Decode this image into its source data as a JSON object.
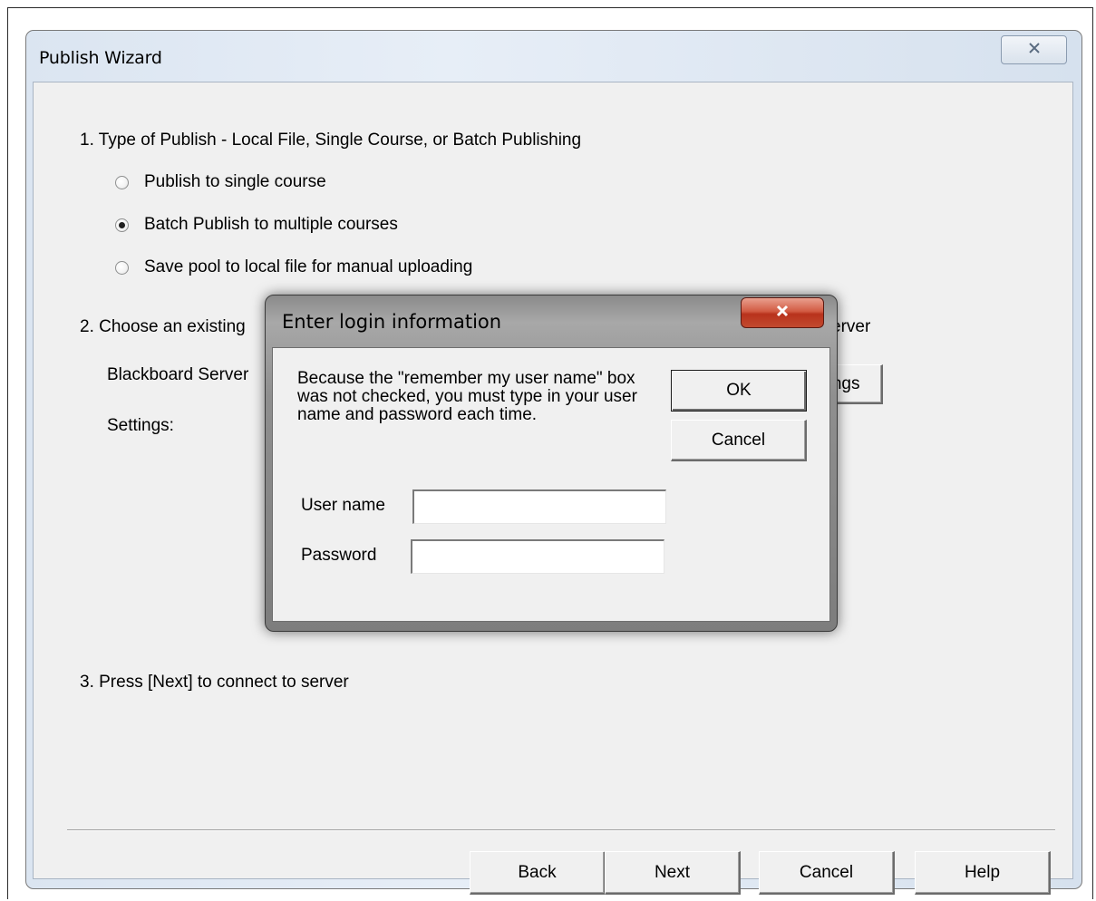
{
  "wizard": {
    "title": "Publish Wizard",
    "step1": "1.  Type of Publish - Local File, Single Course, or Batch Publishing",
    "options": [
      {
        "label": "Publish to single course",
        "checked": false
      },
      {
        "label": "Batch Publish to multiple courses",
        "checked": true
      },
      {
        "label": "Save pool to local file for manual uploading",
        "checked": false
      }
    ],
    "step2_left": "2.  Choose an existing",
    "step2_right": "erver",
    "server_label": "Blackboard Server",
    "settings_label": "Settings:",
    "settings_button_partial": "ettings",
    "step3": "3.  Press [Next] to connect to server",
    "buttons": {
      "back": "Back",
      "next": "Next",
      "cancel": "Cancel",
      "help": "Help"
    }
  },
  "login": {
    "title": "Enter login information",
    "message": "Because the \"remember my user name\" box was not checked, you must type in your user name and password each time.",
    "ok": "OK",
    "cancel": "Cancel",
    "username_label": "User name",
    "password_label": "Password",
    "username_value": "",
    "password_value": ""
  },
  "colors": {
    "dialog_bg": "#f0f0f0",
    "close_red": "#c24a2f"
  },
  "icons": {
    "wizard_close": "close-icon",
    "login_close": "close-icon"
  }
}
